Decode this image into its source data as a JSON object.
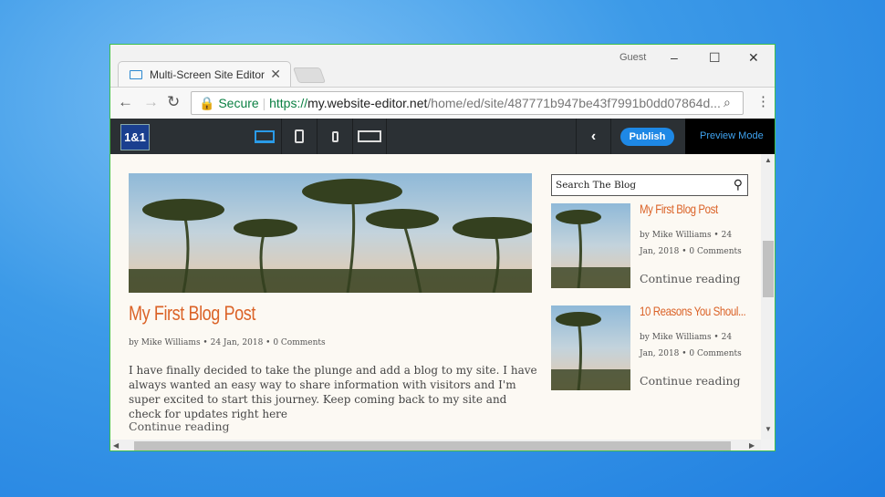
{
  "browser": {
    "tab_title": "Multi-Screen Site Editor",
    "profile": "Guest",
    "secure_label": "Secure",
    "url_scheme": "https://",
    "url_host": "my.website-editor.net",
    "url_path": "/home/ed/site/487771b947be43f7991b0dd07864d..."
  },
  "editor": {
    "logo": "1&1",
    "publish_label": "Publish",
    "preview_label": "Preview Mode",
    "devices": [
      "desktop",
      "tablet",
      "phone",
      "multi-device"
    ],
    "active_device": "desktop"
  },
  "post": {
    "title": "My First Blog Post",
    "meta": "by Mike Williams • 24 Jan, 2018 • 0 Comments",
    "body": "I have finally decided to take the plunge and add a blog to my site. I have always wanted an easy way to share information with visitors and I'm super excited to start this journey. Keep coming back to my site and check for updates right here",
    "continue": "Continue reading"
  },
  "sidebar": {
    "search_placeholder": "Search The Blog",
    "posts": [
      {
        "title": "My First Blog Post",
        "meta1": "by Mike Williams • 24",
        "meta2": "Jan, 2018 • 0 Comments",
        "continue": "Continue reading"
      },
      {
        "title": "10 Reasons You Shoul...",
        "meta1": "by Mike Williams • 24",
        "meta2": "Jan, 2018 • 0 Comments",
        "continue": "Continue reading"
      }
    ]
  },
  "colors": {
    "accent": "#db6328",
    "publish": "#1e88e5",
    "toolbar": "#2b3034"
  }
}
